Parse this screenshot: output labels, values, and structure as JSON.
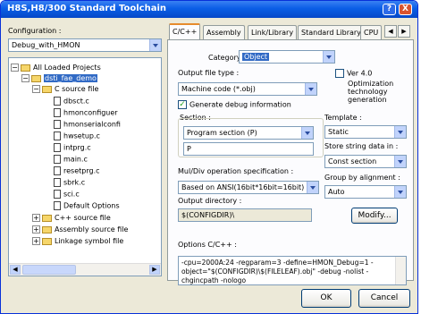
{
  "window": {
    "title": "H8S,H8/300 Standard Toolchain",
    "help_glyph": "?",
    "close_glyph": "X"
  },
  "left": {
    "config_label": "Configuration :",
    "config_value": "Debug_with_HMON",
    "tree": [
      {
        "label": "All Loaded Projects"
      },
      {
        "label": "dsti_fae_demo"
      },
      {
        "label": "C source file"
      },
      {
        "label": "dbsct.c"
      },
      {
        "label": "hmonconfiguer"
      },
      {
        "label": "hmonserialconfi"
      },
      {
        "label": "hwsetup.c"
      },
      {
        "label": "intprg.c"
      },
      {
        "label": "main.c"
      },
      {
        "label": "resetprg.c"
      },
      {
        "label": "sbrk.c"
      },
      {
        "label": "sci.c"
      },
      {
        "label": "Default Options"
      },
      {
        "label": "C++ source file"
      },
      {
        "label": "Assembly source file"
      },
      {
        "label": "Linkage symbol file"
      }
    ]
  },
  "tabs": [
    "C/C++",
    "Assembly",
    "Link/Library",
    "Standard Library",
    "CPU"
  ],
  "panel": {
    "category_label": "Category :",
    "category_value": "Object",
    "output_type_label": "Output file type :",
    "output_type_value": "Machine code (*.obj)",
    "gen_debug_label": "Generate debug information",
    "section_label": "Section :",
    "section_value": "Program section (P)",
    "section_text": "P",
    "muldiv_label": "Mul/Div operation specification :",
    "muldiv_value": "Based on ANSI(16bit*16bit=16bit)",
    "output_dir_label": "Output directory :",
    "output_dir_value": "$(CONFIGDIR)\\",
    "modify_label": "Modify...",
    "ver_label": "Ver 4.0",
    "ver_desc": [
      "Optimization",
      "technology",
      "generation"
    ],
    "template_label": "Template :",
    "template_value": "Static",
    "store_label": "Store string data in :",
    "store_value": "Const section",
    "group_label": "Group by alignment :",
    "group_value": "Auto",
    "options_label": "Options C/C++ :",
    "options_text": "-cpu=2000A:24 -regparam=3 -define=HMON_Debug=1 -object=\"$(CONFIGDIR)\\$(FILELEAF).obj\" -debug -nolist -chgincpath -nologo"
  },
  "buttons": {
    "ok": "OK",
    "cancel": "Cancel"
  }
}
